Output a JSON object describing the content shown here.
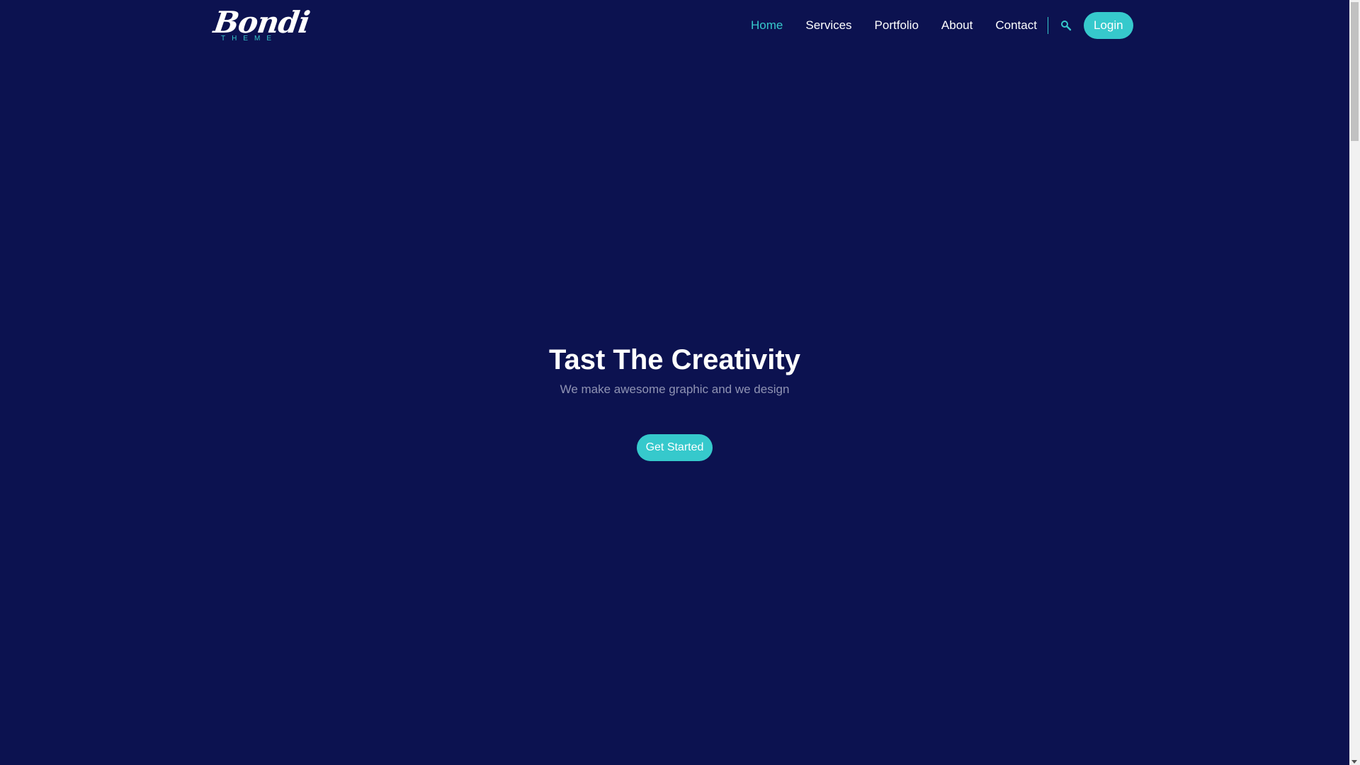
{
  "brand": {
    "name": "Bondi",
    "tagline": "THEME"
  },
  "nav": {
    "items": [
      {
        "label": "Home",
        "active": true
      },
      {
        "label": "Services",
        "active": false
      },
      {
        "label": "Portfolio",
        "active": false
      },
      {
        "label": "About",
        "active": false
      },
      {
        "label": "Contact",
        "active": false
      }
    ],
    "search_icon": "search-icon",
    "login_label": "Login"
  },
  "hero": {
    "title": "Tast The Creativity",
    "subtitle": "We make awesome graphic and we design",
    "cta_label": "Get Started"
  },
  "colors": {
    "background": "#0c1250",
    "accent": "#36c9cc",
    "text": "#ffffff",
    "muted": "#8f93b3"
  }
}
